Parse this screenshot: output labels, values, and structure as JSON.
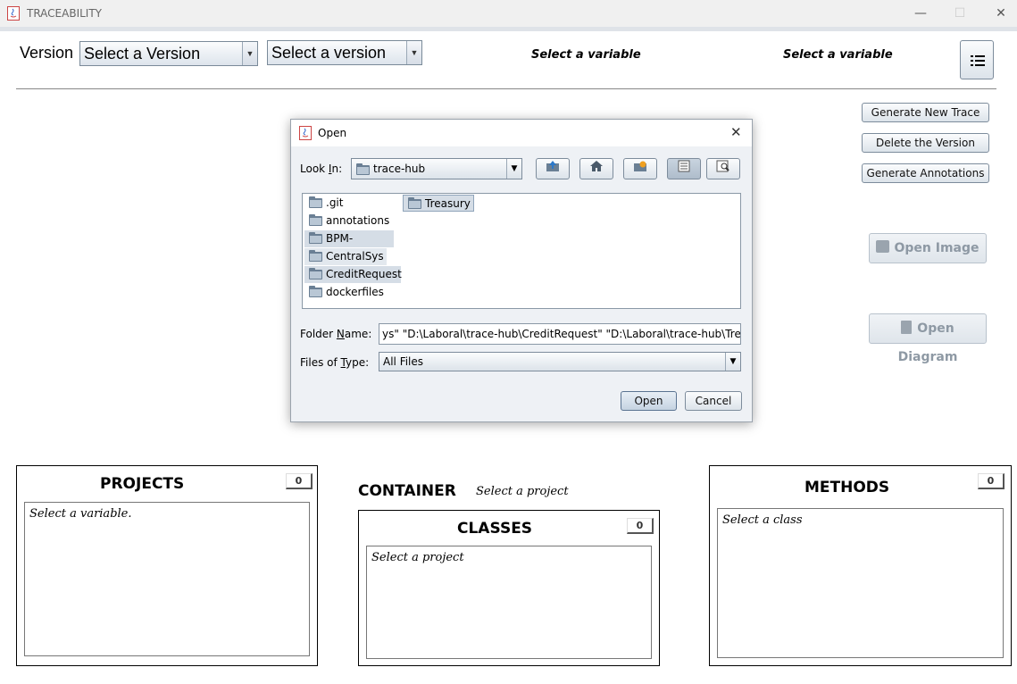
{
  "window": {
    "title": "TRACEABILITY",
    "controls": [
      "—",
      "☐",
      "✕"
    ]
  },
  "toolbar": {
    "version_label": "Version",
    "version_select_1": "Select a Version",
    "version_select_2": "Select a version",
    "variable_label_1": "Select a variable",
    "variable_label_2": "Select a variable",
    "menu_icon": "list-icon"
  },
  "actions": {
    "generate_trace": "Generate New Trace",
    "delete_version": "Delete the Version",
    "generate_annotations": "Generate Annotations",
    "open_image": "Open Image",
    "open_diagram": "Open Diagram"
  },
  "panels": {
    "projects": {
      "title": "PROJECTS",
      "count": "0",
      "placeholder": "Select a variable."
    },
    "container": {
      "title": "CONTAINER",
      "subtitle": "Select a project"
    },
    "classes": {
      "title": "CLASSES",
      "count": "0",
      "placeholder": "Select a project"
    },
    "methods": {
      "title": "METHODS",
      "count": "0",
      "placeholder": "Select a class"
    }
  },
  "dialog": {
    "title": "Open",
    "look_in_label_pre": "Look ",
    "look_in_label_u": "I",
    "look_in_label_post": "n:",
    "look_in_value": "trace-hub",
    "toolbar_icons": [
      "up-folder-icon",
      "home-icon",
      "new-folder-icon",
      "list-view-icon",
      "details-view-icon"
    ],
    "files": [
      ".git",
      "annotations",
      "BPM-Engine",
      "CentralSys",
      "CreditRequest",
      "dockerfiles",
      "Treasury"
    ],
    "folder_name_label_pre": "Folder ",
    "folder_name_label_u": "N",
    "folder_name_label_post": "ame:",
    "folder_name_value": "ys\" \"D:\\Laboral\\trace-hub\\CreditRequest\" \"D:\\Laboral\\trace-hub\\Treasury\"",
    "file_type_label_pre": "Files of ",
    "file_type_label_u": "T",
    "file_type_label_post": "ype:",
    "file_type_value": "All Files",
    "open_button": "Open",
    "cancel_button": "Cancel"
  },
  "colors": {
    "selection": "#d5dde6",
    "panel_border": "#000000",
    "dialog_bg": "#eef1f5"
  }
}
